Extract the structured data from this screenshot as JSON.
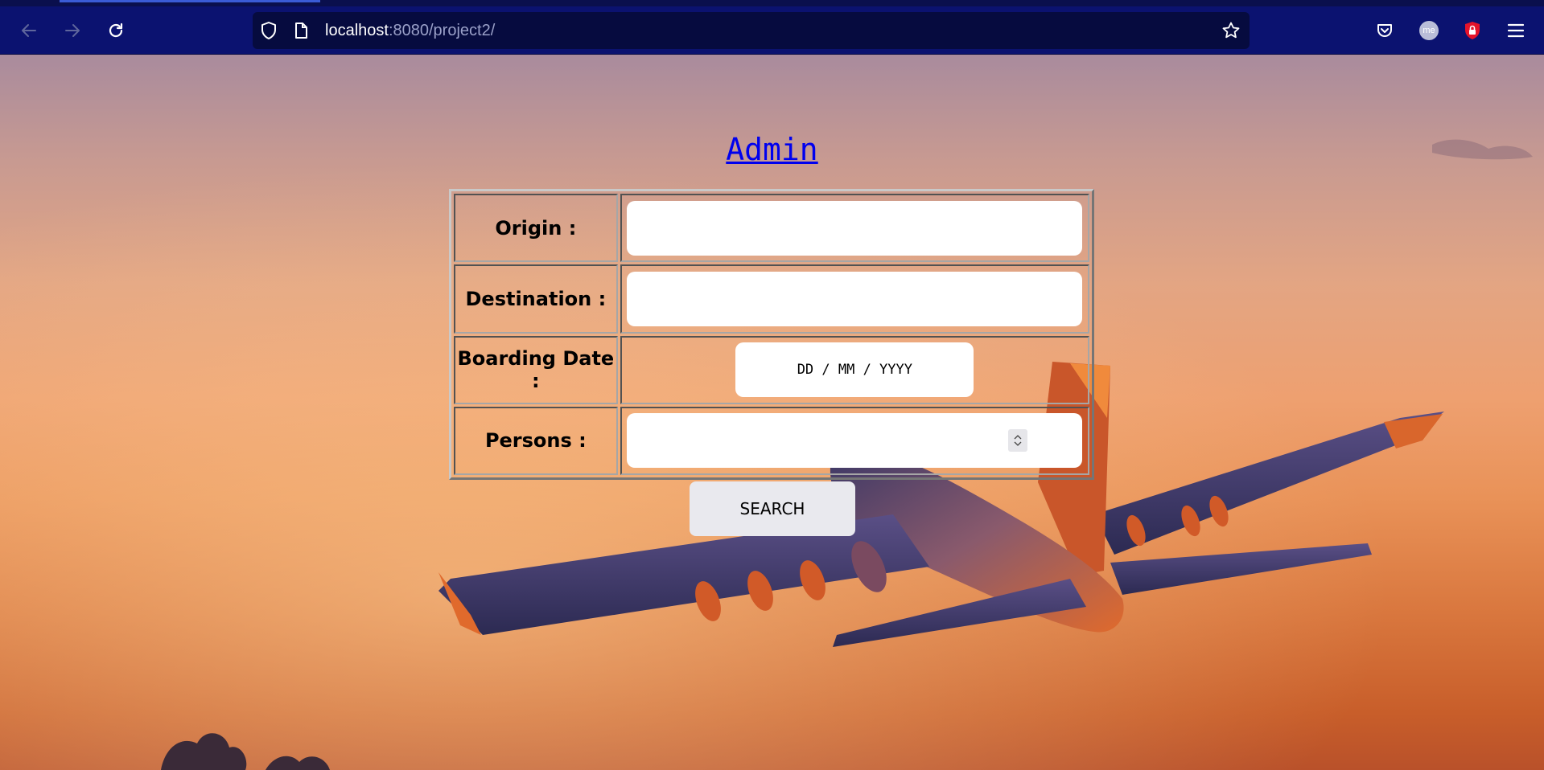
{
  "browser": {
    "url_host": "localhost",
    "url_path": ":8080/project2/",
    "avatar_initials": "me",
    "accent": "#0b1270"
  },
  "icons": {
    "back": "arrow-left-icon",
    "forward": "arrow-right-icon",
    "reload": "reload-icon",
    "shield": "shield-icon",
    "page": "page-icon",
    "bookmark": "star-icon",
    "pocket": "pocket-icon",
    "account": "avatar",
    "extension": "lock-shield-icon",
    "menu": "hamburger-icon"
  },
  "page": {
    "admin_link": "Admin",
    "form": {
      "origin_label": "Origin :",
      "destination_label": "Destination :",
      "boarding_date_label": "Boarding Date :",
      "boarding_date_placeholder": "DD / MM / YYYY",
      "persons_label": "Persons :",
      "origin_value": "",
      "destination_value": "",
      "persons_value": ""
    },
    "search_button": "SEARCH"
  }
}
